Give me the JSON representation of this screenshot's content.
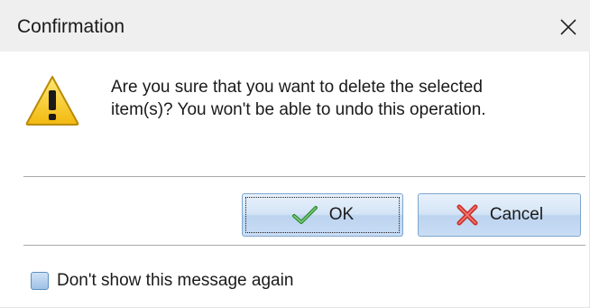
{
  "window": {
    "title": "Confirmation",
    "close_icon": "close-icon"
  },
  "message": {
    "icon": "warning-icon",
    "line1": "Are you sure that you want to delete the selected",
    "line2": "item(s)? You won't be able to undo this operation."
  },
  "buttons": {
    "ok_label": "OK",
    "ok_icon": "checkmark-icon",
    "cancel_label": "Cancel",
    "cancel_icon": "red-x-icon"
  },
  "checkbox": {
    "label": "Don't show this message again",
    "checked": false
  },
  "colors": {
    "titlebar_bg": "#efefef",
    "button_border": "#7fa6cf",
    "warning_yellow": "#f5c518",
    "ok_green": "#3aa23a",
    "cancel_red": "#d9362b"
  }
}
